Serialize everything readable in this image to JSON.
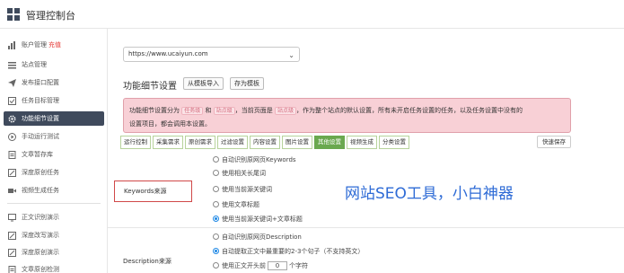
{
  "app": {
    "title": "管理控制台"
  },
  "sidebar": {
    "items": [
      {
        "label": "账户管理",
        "badge": "充值",
        "icon": "bar-chart-icon"
      },
      {
        "label": "站点管理",
        "icon": "list-icon"
      },
      {
        "label": "发布接口配置",
        "icon": "send-icon"
      },
      {
        "label": "任务目标管理",
        "icon": "checklist-icon"
      },
      {
        "label": "功能细节设置",
        "icon": "gear-icon",
        "active": true
      },
      {
        "label": "手动运行测试",
        "icon": "play-icon"
      },
      {
        "label": "文章暂存库",
        "icon": "document-icon"
      },
      {
        "label": "深度原创任务",
        "icon": "edit-icon"
      },
      {
        "label": "视频生成任务",
        "icon": "video-icon"
      },
      {
        "label": "正文识别演示",
        "icon": "monitor-icon"
      },
      {
        "label": "深度改写演示",
        "icon": "edit-icon"
      },
      {
        "label": "深度原创演示",
        "icon": "edit-icon"
      },
      {
        "label": "文章原创检测",
        "icon": "document-icon"
      }
    ]
  },
  "main": {
    "site_select": "https://www.ucaiyun.com",
    "section_title": "功能细节设置",
    "import_button": "从模板导入",
    "save_template_button": "存为模板",
    "alert": {
      "part1": "功能细节设置分为",
      "chip1": "任务级",
      "part2": "和",
      "chip2": "站点级",
      "part3": "，当前页面是",
      "chip3": "站点级",
      "part4": "，作为整个站点的默认设置，所有未开启任务设置的任务，以及任务设置中没有的",
      "line2": "设置项目，都会调用本设置。"
    },
    "tabs": [
      "运行控制",
      "采集需求",
      "原创需求",
      "过滤设置",
      "内容设置",
      "图片设置",
      "其他设置",
      "视频生成",
      "分类设置"
    ],
    "active_tab": "其他设置",
    "quick_save": "快速保存",
    "keywords_label": "Keywords来源",
    "keywords_options": [
      {
        "label": "自动识别原网页Keywords",
        "checked": false
      },
      {
        "label": "使用相关长尾词",
        "checked": false
      },
      {
        "label": "使用当前源关键词",
        "checked": false
      },
      {
        "label": "使用文章标题",
        "checked": false
      },
      {
        "label": "使用当前源关键词+文章标题",
        "checked": true
      }
    ],
    "description_label": "Description来源",
    "description_options": [
      {
        "label": "自动识别原网页Description",
        "checked": false
      },
      {
        "label": "自动提取正文中最重要的2-3个句子（不支持英文）",
        "checked": true
      },
      {
        "label_before": "使用正文开头前",
        "value": "0",
        "label_after": "个字符",
        "checked": false
      }
    ],
    "watermark": "网站SEO工具，小白神器"
  },
  "colors": {
    "active_sidebar": "#3f4a5c",
    "active_tab": "#6aa84f",
    "alert_bg": "#f8d0d6",
    "watermark": "#2e6bd6",
    "badge": "#e53935",
    "highlight_box": "#d04848"
  }
}
